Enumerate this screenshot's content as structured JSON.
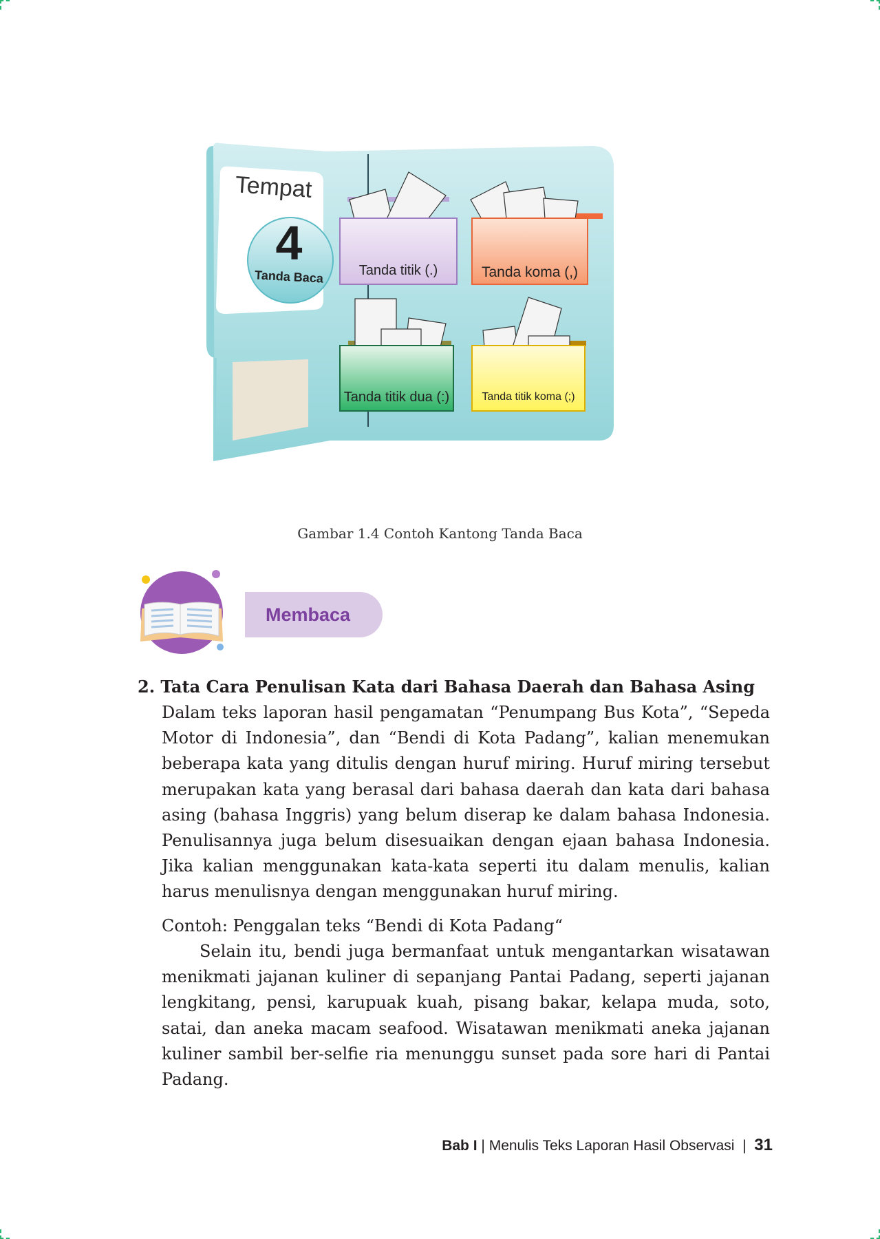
{
  "figure": {
    "card_title": "Tempat",
    "card_number": "4",
    "card_subtitle": "Tanda Baca",
    "pockets": [
      {
        "label": "Tanda titik (.)"
      },
      {
        "label": "Tanda koma (,)"
      },
      {
        "label": "Tanda titik dua (:)"
      },
      {
        "label": "Tanda titik koma (;)"
      }
    ],
    "caption": "Gambar 1.4 Contoh Kantong Tanda Baca"
  },
  "section_header": {
    "label": "Membaca",
    "icon": "open-book-icon"
  },
  "section": {
    "title": "2. Tata Cara Penulisan Kata dari Bahasa Daerah dan Bahasa Asing",
    "paragraph": "Dalam teks laporan hasil pengamatan “Penumpang Bus Kota”, “Sepeda Motor di Indonesia”, dan “Bendi di Kota Padang”, kalian menemukan beberapa kata yang ditulis dengan huruf miring. Huruf miring tersebut merupakan kata yang berasal dari bahasa daerah dan kata dari bahasa asing (bahasa Inggris) yang belum diserap ke dalam bahasa Indonesia. Penulisannya juga belum disesuaikan dengan ejaan bahasa Indonesia. Jika kalian menggunakan kata-kata seperti itu dalam menulis, kalian harus menulisnya dengan menggunakan huruf miring.",
    "example_label": "Contoh: Penggalan teks “Bendi di Kota Padang“",
    "example_text": "Selain itu, bendi juga bermanfaat untuk mengantarkan wisatawan menikmati jajanan kuliner di sepanjang Pantai Padang, seperti jajanan lengkitang, pensi, karupuak kuah, pisang bakar, kelapa muda, soto, satai, dan aneka macam seafood. Wisatawan menikmati aneka jajanan kuliner sambil ber-selfie ria menunggu sunset pada sore hari di Pantai Padang."
  },
  "footer": {
    "chapter": "Bab I",
    "sep1": "|",
    "title": "Menulis Teks Laporan Hasil Observasi",
    "sep2": "|",
    "page": "31"
  }
}
